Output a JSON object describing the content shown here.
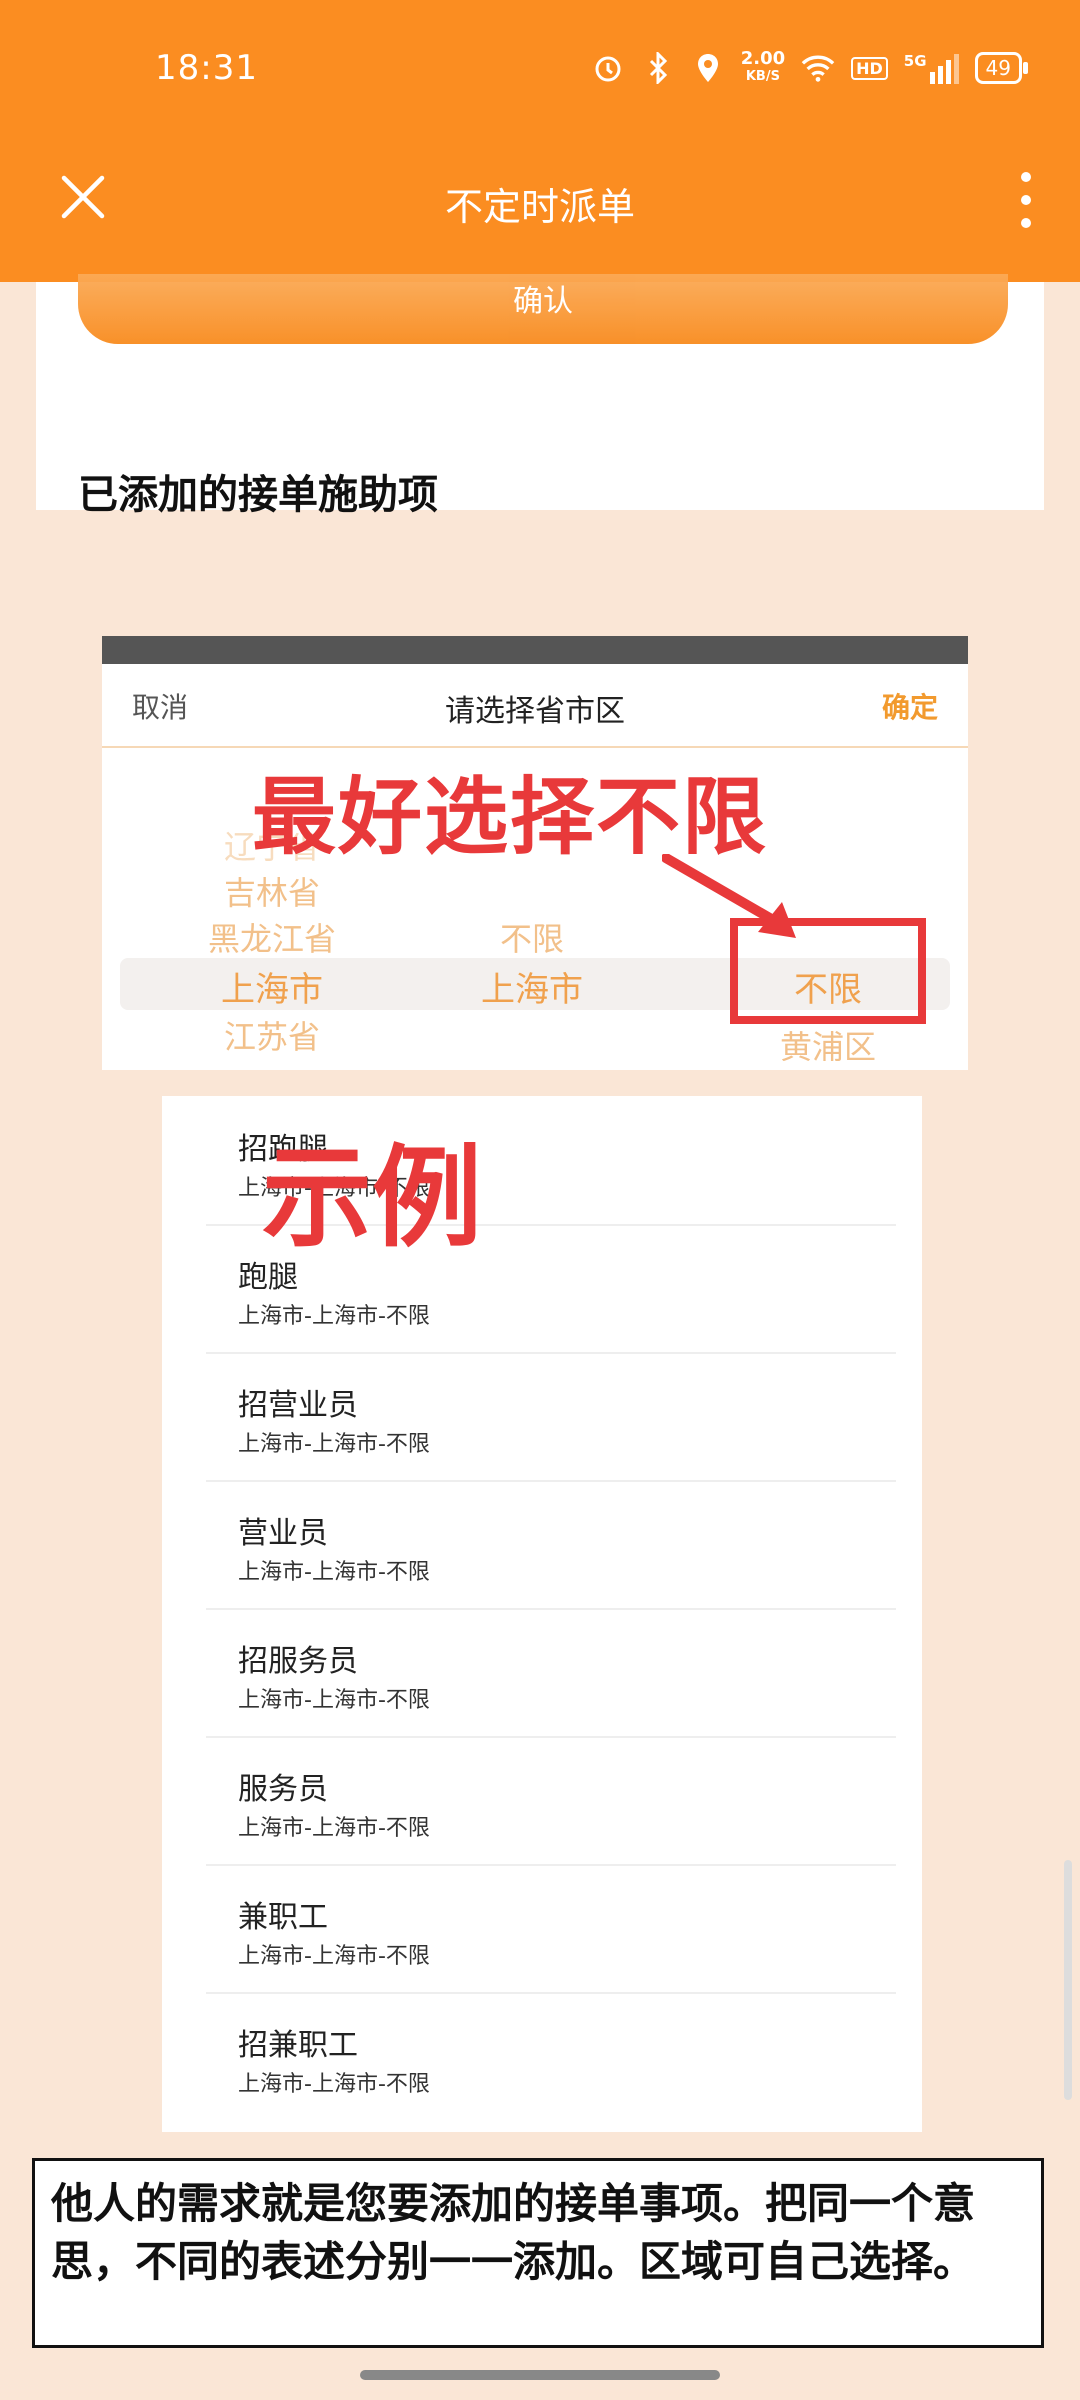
{
  "status_bar": {
    "time": "18:31",
    "speed_top": "2.00",
    "speed_bottom": "KB/S",
    "network": "5G",
    "hd": "HD",
    "battery": "49"
  },
  "header": {
    "title": "不定时派单"
  },
  "top_card": {
    "confirm_label": "确认",
    "added_heading": "已添加的接单施助项"
  },
  "picker": {
    "cancel": "取消",
    "title": "请选择省市区",
    "confirm": "确定",
    "annotation": "最好选择不限",
    "province_col": [
      "辽宁省",
      "吉林省",
      "黑龙江省",
      "上海市",
      "江苏省"
    ],
    "city_col": [
      "不限",
      "上海市"
    ],
    "district_col": [
      "不限",
      "黄浦区"
    ]
  },
  "example_label": "示例",
  "list": [
    {
      "title": "招跑腿",
      "sub": "上海市-上海市-不限"
    },
    {
      "title": "跑腿",
      "sub": "上海市-上海市-不限"
    },
    {
      "title": "招营业员",
      "sub": "上海市-上海市-不限"
    },
    {
      "title": "营业员",
      "sub": "上海市-上海市-不限"
    },
    {
      "title": "招服务员",
      "sub": "上海市-上海市-不限"
    },
    {
      "title": "服务员",
      "sub": "上海市-上海市-不限"
    },
    {
      "title": "兼职工",
      "sub": "上海市-上海市-不限"
    },
    {
      "title": "招兼职工",
      "sub": "上海市-上海市-不限"
    }
  ],
  "note": "他人的需求就是您要添加的接单事项。把同一个意思，不同的表述分别一一添加。区域可自己选择。"
}
